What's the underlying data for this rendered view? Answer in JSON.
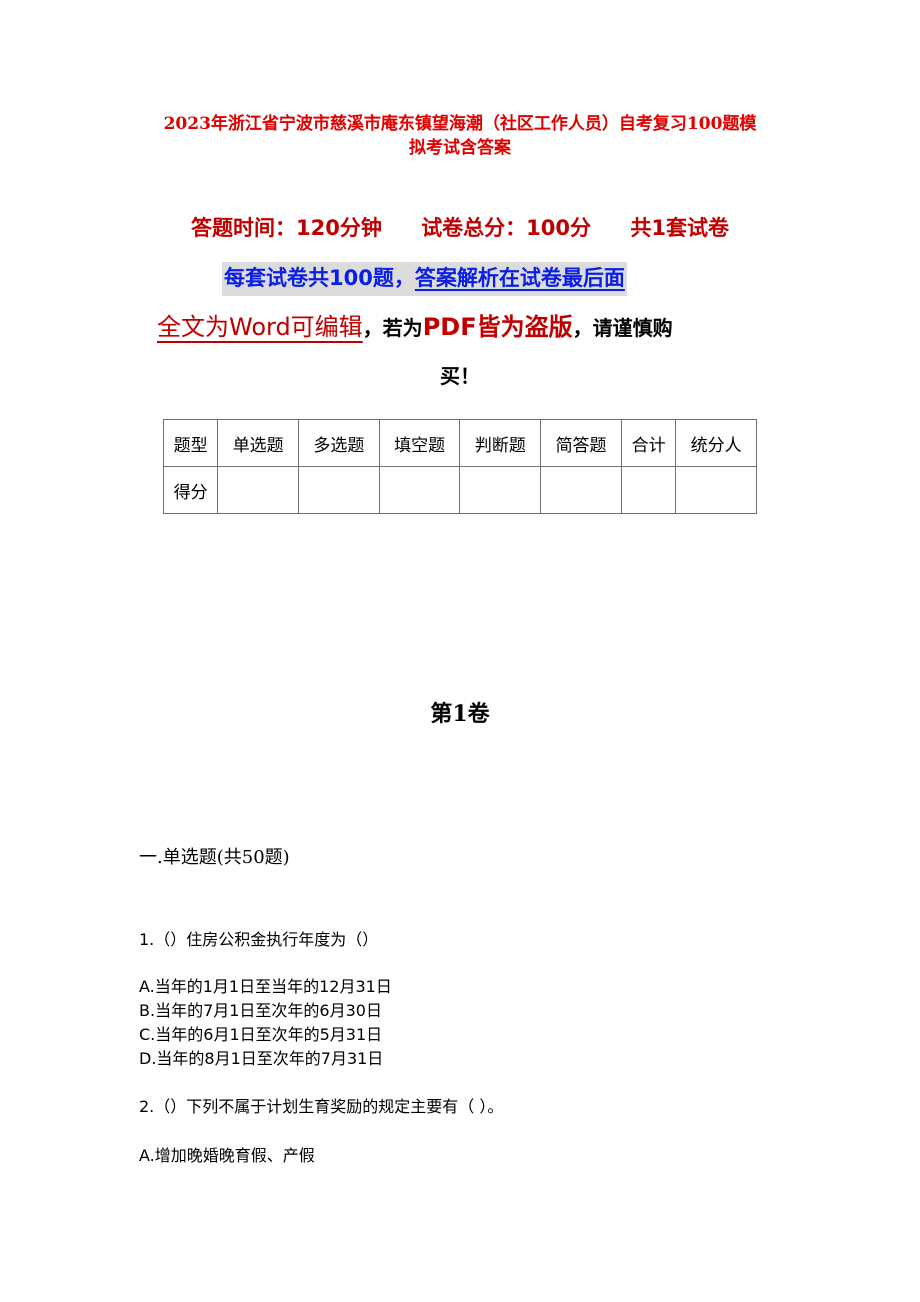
{
  "document": {
    "title_line1": "2023年浙江省宁波市慈溪市庵东镇望海潮（社区工作人员）自考复习100题模",
    "title_line2": "拟考试含答案",
    "meta": {
      "time": "答题时间：120分钟",
      "total": "试卷总分：100分",
      "sets": "共1套试卷"
    },
    "notice": {
      "part1": "每套试卷共100题，",
      "part2": "答案解析在试卷最后面"
    },
    "warning": {
      "editable": "全文为Word可编辑",
      "comma1": "，若为",
      "pdf": "PDF皆为盗版",
      "comma2": "，请谨慎购",
      "line2": "买！"
    },
    "score_table": {
      "header": [
        "题型",
        "单选题",
        "多选题",
        "填空题",
        "判断题",
        "简答题",
        "合计",
        "统分人"
      ],
      "row": [
        "得分",
        "",
        "",
        "",
        "",
        "",
        "",
        ""
      ]
    },
    "volume": "第1卷",
    "section": "一.单选题(共50题)",
    "questions": [
      {
        "stem": "1.（）住房公积金执行年度为（）",
        "options": [
          "A.当年的1月1日至当年的12月31日",
          "B.当年的7月1日至次年的6月30日",
          "C.当年的6月1日至次年的5月31日",
          "D.当年的8月1日至次年的7月31日"
        ]
      },
      {
        "stem": "2.（）下列不属于计划生育奖励的规定主要有（ ）。",
        "options": [
          "A.增加晚婚晚育假、产假"
        ]
      }
    ]
  }
}
